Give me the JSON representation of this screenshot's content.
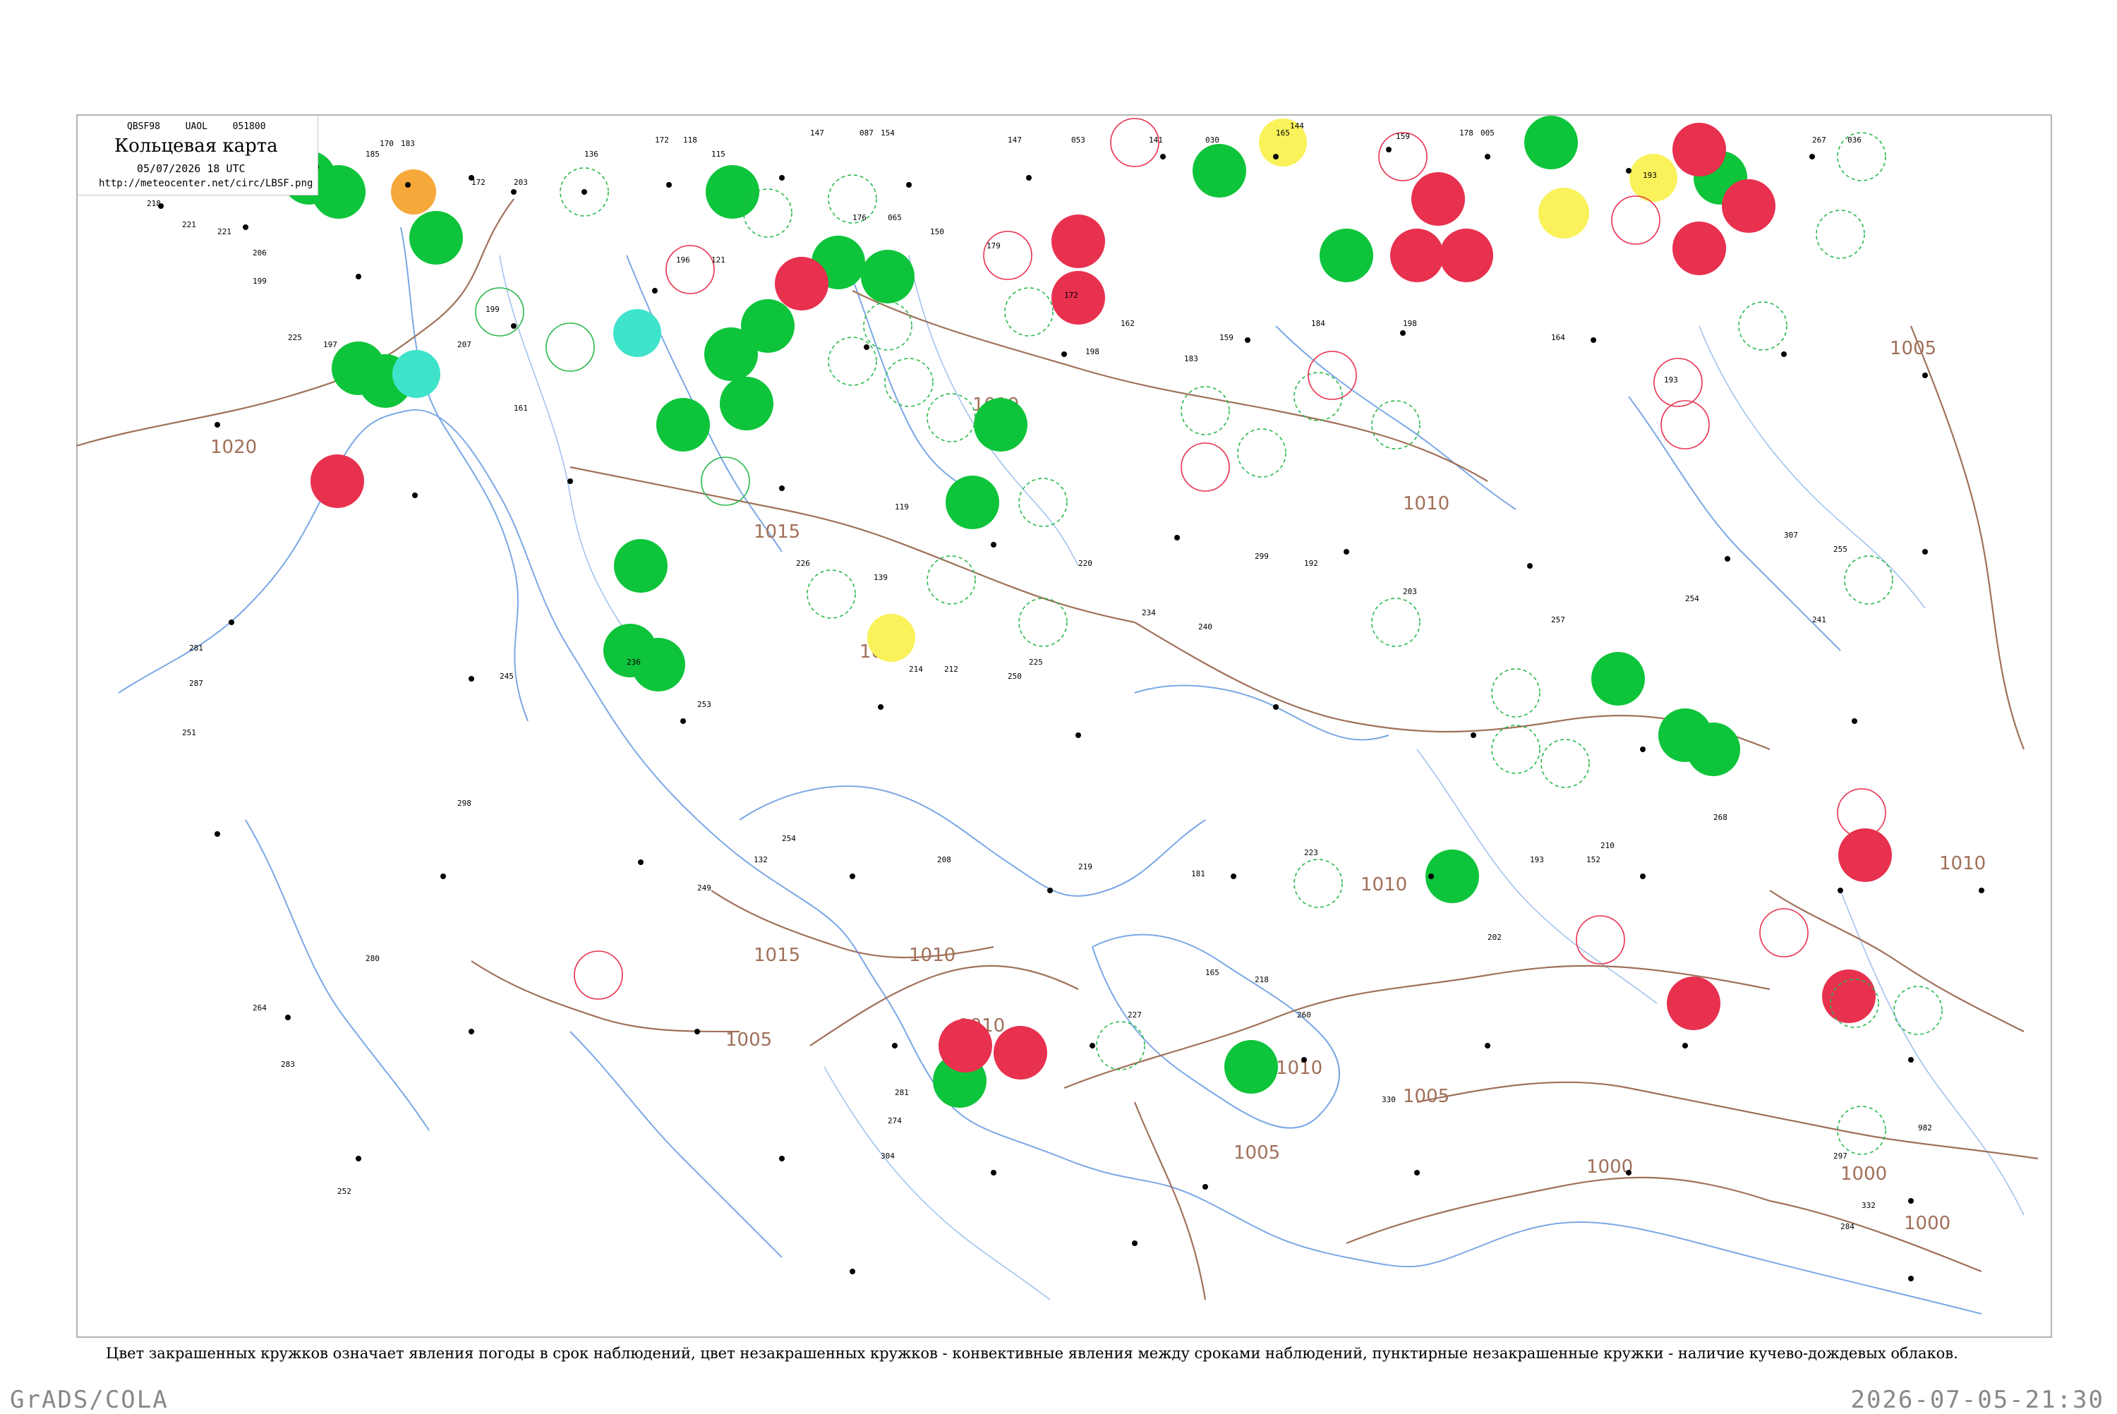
{
  "title": {
    "code_line": "QBSF98  UAOL  051800",
    "main": "Кольцевая карта",
    "date": "05/07/2026 18 UTC",
    "url": "http://meteocenter.net/circ/LBSF.png"
  },
  "caption": "Цвет закрашенных кружков означает явления погоды в срок наблюдений, цвет незакрашенных кружков - конвективные явления между сроками наблюдений, пунктирные незакрашенные кружки - наличие кучево-дождевых облаков.",
  "footer": {
    "left": "GrADS/COLA",
    "right": "2026-07-05-21:30"
  },
  "isobar_labels": [
    "1020",
    "1015",
    "1010",
    "1005",
    "1000",
    "1015",
    "1010",
    "1010",
    "1015",
    "1005",
    "1010",
    "1010",
    "1005",
    "1000",
    "1000",
    "1010",
    "1005",
    "1010"
  ],
  "colors": {
    "thunderstorm": "#0ec43a",
    "shower": "#e8304f",
    "fog": "#3fe3c9",
    "haze": "#f6a83a",
    "snow": "#f9f25a",
    "isobar": "#a0705a",
    "river": "#7aa8e6",
    "border": "#b4b4b4"
  },
  "stations": [
    {
      "v": "221"
    },
    {
      "v": "185"
    },
    {
      "v": "170"
    },
    {
      "v": "183"
    },
    {
      "v": "172"
    },
    {
      "v": "203"
    },
    {
      "v": "136"
    },
    {
      "v": "172"
    },
    {
      "v": "118"
    },
    {
      "v": "115"
    },
    {
      "v": "147"
    },
    {
      "v": "087"
    },
    {
      "v": "154"
    },
    {
      "v": "147"
    },
    {
      "v": "053"
    },
    {
      "v": "141"
    },
    {
      "v": "030"
    },
    {
      "v": "165"
    },
    {
      "v": "144"
    },
    {
      "v": "159"
    },
    {
      "v": "178"
    },
    {
      "v": "005"
    },
    {
      "v": "193"
    },
    {
      "v": "267"
    },
    {
      "v": "036"
    },
    {
      "v": "218"
    },
    {
      "v": "221"
    },
    {
      "v": "206"
    },
    {
      "v": "199"
    },
    {
      "v": "225"
    },
    {
      "v": "197"
    },
    {
      "v": "207"
    },
    {
      "v": "199"
    },
    {
      "v": "161"
    },
    {
      "v": "196"
    },
    {
      "v": "121"
    },
    {
      "v": "176"
    },
    {
      "v": "065"
    },
    {
      "v": "150"
    },
    {
      "v": "179"
    },
    {
      "v": "172"
    },
    {
      "v": "198"
    },
    {
      "v": "162"
    },
    {
      "v": "159"
    },
    {
      "v": "184"
    },
    {
      "v": "198"
    },
    {
      "v": "164"
    },
    {
      "v": "193"
    },
    {
      "v": "183"
    },
    {
      "v": "119"
    },
    {
      "v": "226"
    },
    {
      "v": "139"
    },
    {
      "v": "214"
    },
    {
      "v": "212"
    },
    {
      "v": "250"
    },
    {
      "v": "225"
    },
    {
      "v": "220"
    },
    {
      "v": "234"
    },
    {
      "v": "240"
    },
    {
      "v": "299"
    },
    {
      "v": "192"
    },
    {
      "v": "203"
    },
    {
      "v": "257"
    },
    {
      "v": "254"
    },
    {
      "v": "307"
    },
    {
      "v": "255"
    },
    {
      "v": "241"
    },
    {
      "v": "281"
    },
    {
      "v": "287"
    },
    {
      "v": "251"
    },
    {
      "v": "236"
    },
    {
      "v": "253"
    },
    {
      "v": "298"
    },
    {
      "v": "245"
    },
    {
      "v": "254"
    },
    {
      "v": "132"
    },
    {
      "v": "208"
    },
    {
      "v": "219"
    },
    {
      "v": "181"
    },
    {
      "v": "223"
    },
    {
      "v": "193"
    },
    {
      "v": "210"
    },
    {
      "v": "152"
    },
    {
      "v": "249"
    },
    {
      "v": "202"
    },
    {
      "v": "165"
    },
    {
      "v": "218"
    },
    {
      "v": "227"
    },
    {
      "v": "260"
    },
    {
      "v": "283"
    },
    {
      "v": "264"
    },
    {
      "v": "280"
    },
    {
      "v": "252"
    },
    {
      "v": "304"
    },
    {
      "v": "274"
    },
    {
      "v": "281"
    },
    {
      "v": "330"
    },
    {
      "v": "332"
    },
    {
      "v": "284"
    },
    {
      "v": "297"
    },
    {
      "v": "982"
    },
    {
      "v": "268"
    }
  ]
}
